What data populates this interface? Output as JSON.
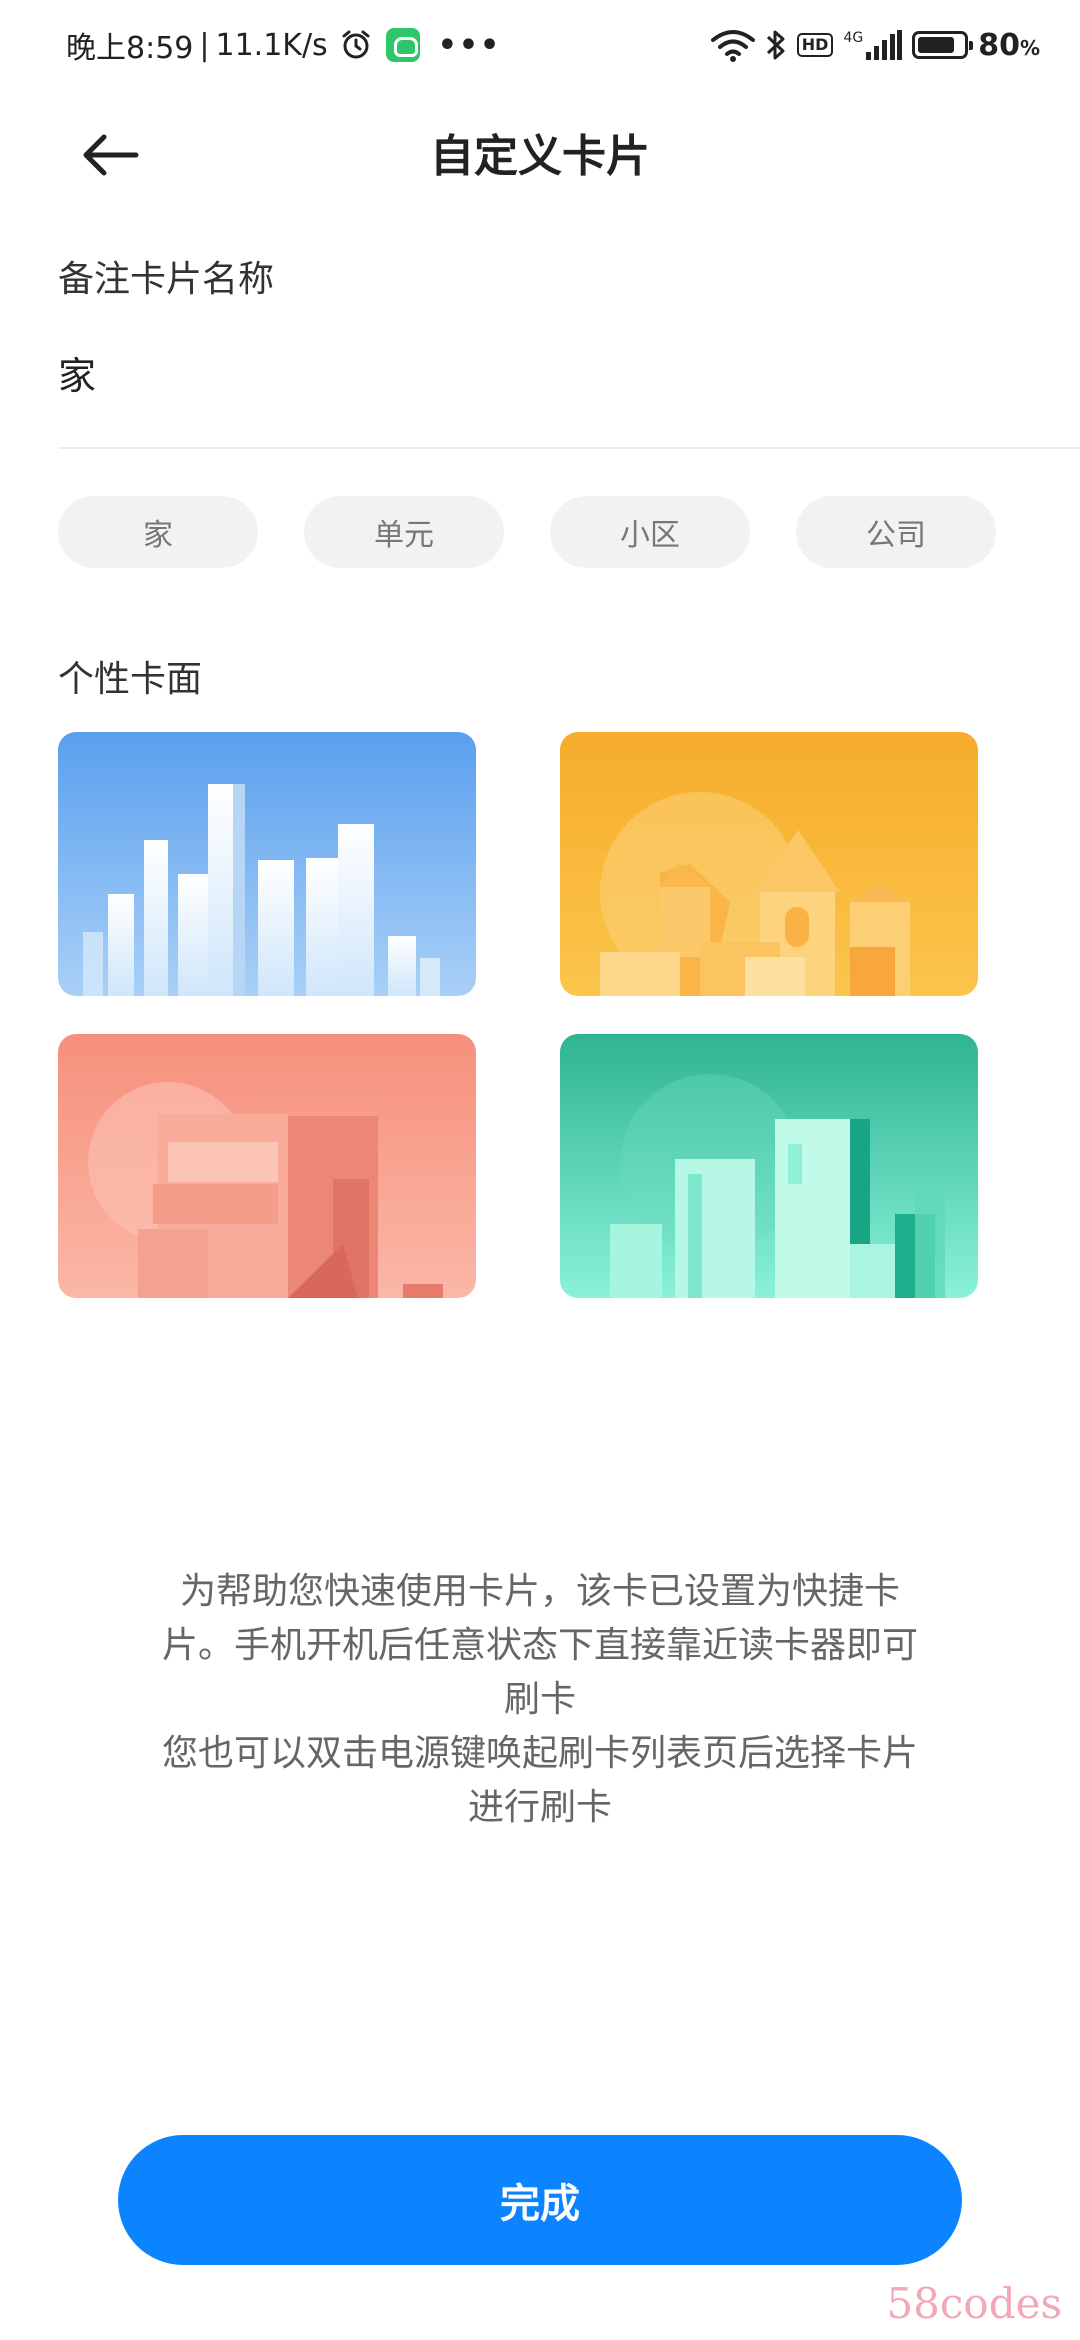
{
  "status_bar": {
    "time": "晚上8:59",
    "net_speed": "11.1K/s",
    "separator": "|",
    "more": "•••",
    "net_type": "4G",
    "hd": "HD",
    "battery": "80",
    "battery_unit": "%"
  },
  "header": {
    "title": "自定义卡片"
  },
  "name_section": {
    "label": "备注卡片名称",
    "value": "家"
  },
  "chips": [
    "家",
    "单元",
    "小区",
    "公司"
  ],
  "card_face_section": {
    "label": "个性卡面"
  },
  "info_text": {
    "line1": "为帮助您快速使用卡片，该卡已设置为快捷卡",
    "line2": "片。手机开机后任意状态下直接靠近读卡器即可",
    "line3": "刷卡",
    "line4": "您也可以双击电源键唤起刷卡列表页后选择卡片",
    "line5": "进行刷卡"
  },
  "done_button": {
    "label": "完成"
  },
  "watermark": "58codes",
  "colors": {
    "accent": "#0d84ff",
    "card_blue": "#5aa3ee",
    "card_orange": "#f5b032",
    "card_coral": "#f79a86",
    "card_teal": "#2fb995"
  }
}
